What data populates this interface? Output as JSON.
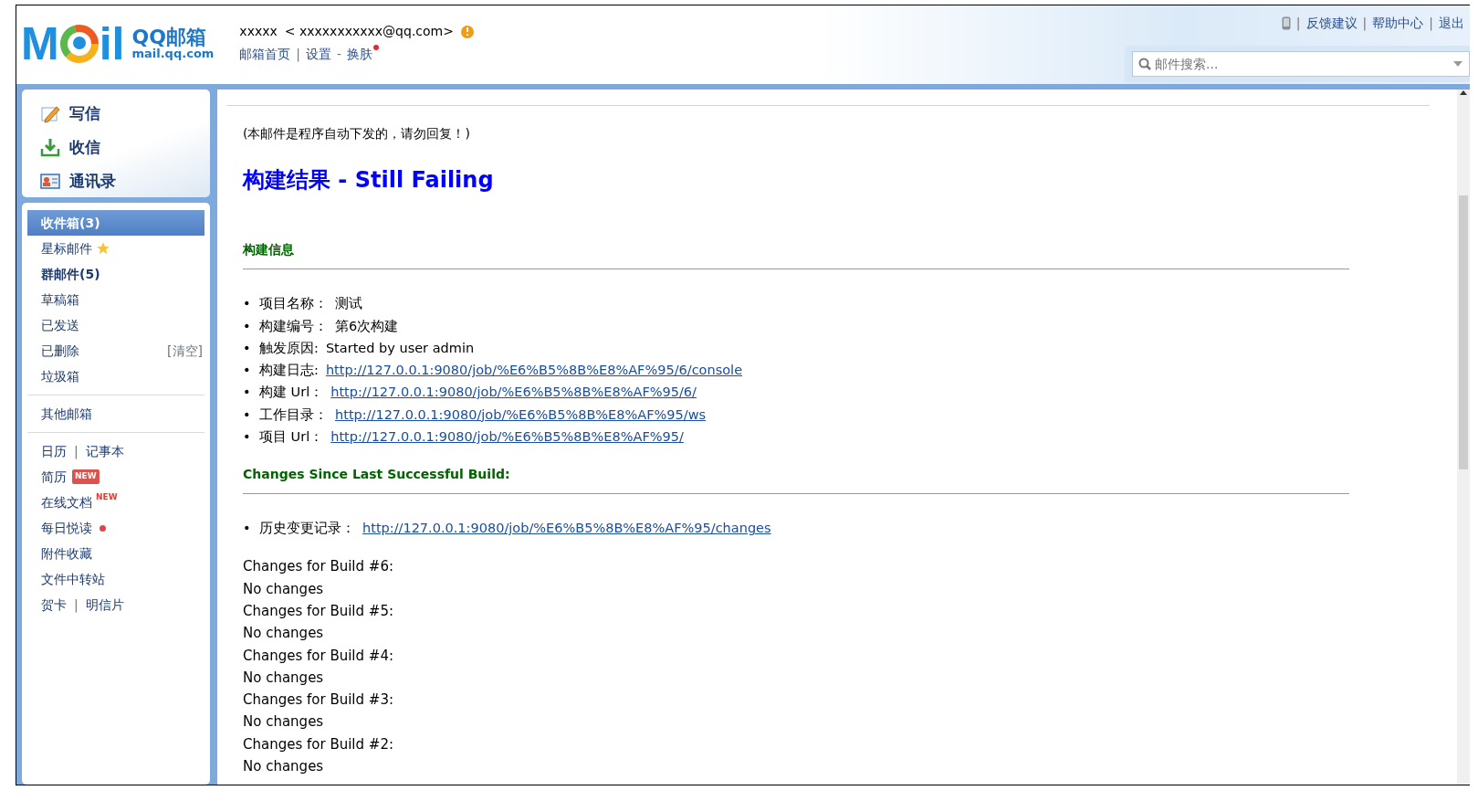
{
  "header": {
    "logo": {
      "left": "M",
      "right": "il",
      "brand": "QQ邮箱",
      "domain": "mail.qq.com"
    },
    "account": {
      "name": "xxxxx",
      "email": "< xxxxxxxxxxx@qq.com>",
      "alert": true
    },
    "nav": [
      {
        "kind": "link",
        "text": "邮箱首页"
      },
      {
        "kind": "sep",
        "text": "|"
      },
      {
        "kind": "link",
        "text": "设置"
      },
      {
        "kind": "sep",
        "text": "-"
      },
      {
        "kind": "link",
        "text": "换肤",
        "dot": true
      }
    ],
    "top_links": [
      {
        "kind": "phone"
      },
      {
        "kind": "sep",
        "text": "|"
      },
      {
        "kind": "link",
        "text": "反馈建议"
      },
      {
        "kind": "sep",
        "text": "|"
      },
      {
        "kind": "link",
        "text": "帮助中心"
      },
      {
        "kind": "sep",
        "text": "|"
      },
      {
        "kind": "link",
        "text": "退出"
      }
    ],
    "search": {
      "placeholder": "邮件搜索..."
    }
  },
  "actions": [
    {
      "kind": "compose",
      "label": "写信"
    },
    {
      "kind": "receive",
      "label": "收信"
    },
    {
      "kind": "contacts",
      "label": "通讯录"
    }
  ],
  "sidebar": {
    "sections": [
      [
        {
          "label": "收件箱(3)",
          "selected": true,
          "bold": true
        },
        {
          "label": "星标邮件",
          "selected": false,
          "bold": false,
          "badge": {
            "kind": "star"
          }
        },
        {
          "label": "群邮件(5)",
          "selected": false,
          "bold": true
        },
        {
          "label": "草稿箱",
          "selected": false,
          "bold": false
        },
        {
          "label": "已发送",
          "selected": false,
          "bold": false
        },
        {
          "label": "已删除",
          "selected": false,
          "bold": false,
          "extra": "[清空]"
        },
        {
          "label": "垃圾箱",
          "selected": false,
          "bold": false
        }
      ],
      [
        {
          "label": "其他邮箱",
          "selected": false,
          "bold": false
        }
      ],
      [
        {
          "links": [
            "日历",
            "记事本"
          ],
          "sep": "|"
        },
        {
          "label": "简历",
          "selected": false,
          "bold": false,
          "badge": {
            "kind": "new",
            "text": "NEW"
          }
        },
        {
          "label": "在线文档",
          "selected": false,
          "bold": false,
          "badge": {
            "kind": "new-sup",
            "text": "NEW"
          }
        },
        {
          "label": "每日悦读",
          "selected": false,
          "bold": false,
          "badge": {
            "kind": "dot"
          }
        },
        {
          "label": "附件收藏",
          "selected": false,
          "bold": false
        },
        {
          "label": "文件中转站",
          "selected": false,
          "bold": false
        },
        {
          "links": [
            "贺卡",
            "明信片"
          ],
          "sep": "|"
        }
      ]
    ]
  },
  "email": {
    "notice": "(本邮件是程序自动下发的，请勿回复！)",
    "title": "构建结果 - Still Failing",
    "sections": [
      {
        "heading": "构建信息",
        "marker": "•",
        "items": [
          {
            "label": "项目名称：",
            "kind": "text",
            "value": "测试"
          },
          {
            "label": "构建编号：",
            "kind": "text",
            "value": "第6次构建"
          },
          {
            "label": "触发原因:",
            "kind": "text",
            "value": "Started by user admin"
          },
          {
            "label": "构建日志:",
            "kind": "link",
            "value": "http://127.0.0.1:9080/job/%E6%B5%8B%E8%AF%95/6/console"
          },
          {
            "label": "构建 Url：",
            "kind": "link",
            "value": "http://127.0.0.1:9080/job/%E6%B5%8B%E8%AF%95/6/"
          },
          {
            "label": "工作目录：",
            "kind": "link",
            "value": "http://127.0.0.1:9080/job/%E6%B5%8B%E8%AF%95/ws"
          },
          {
            "label": "项目 Url：",
            "kind": "link",
            "value": "http://127.0.0.1:9080/job/%E6%B5%8B%E8%AF%95/"
          }
        ]
      },
      {
        "heading": "Changes Since Last Successful Build:",
        "marker": "•",
        "items": [
          {
            "label": "历史变更记录：",
            "kind": "link",
            "value": "http://127.0.0.1:9080/job/%E6%B5%8B%E8%AF%95/changes"
          }
        ]
      }
    ],
    "lines": [
      "Changes for Build #6:",
      "No changes",
      "Changes for Build #5:",
      "No changes",
      "Changes for Build #4:",
      "No changes",
      "Changes for Build #3:",
      "No changes",
      "Changes for Build #2:",
      "No changes"
    ]
  }
}
